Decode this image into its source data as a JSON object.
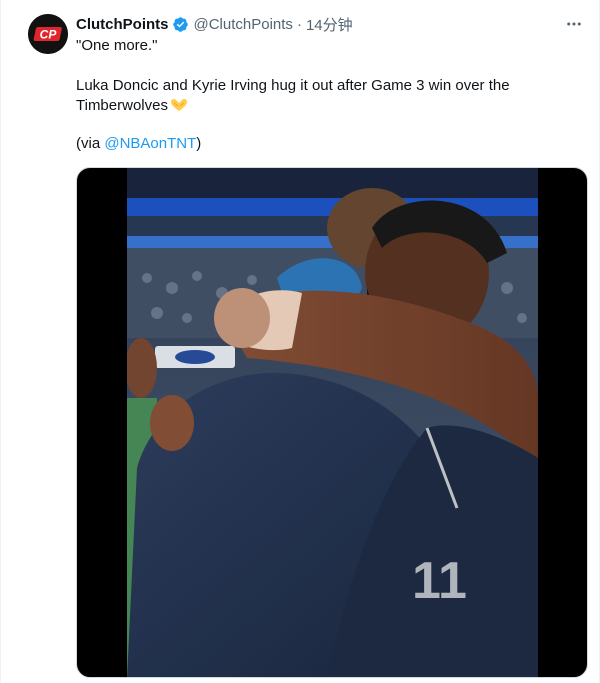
{
  "tweet": {
    "display_name": "ClutchPoints",
    "handle": "@ClutchPoints",
    "separator": "·",
    "time": "14分钟",
    "avatar_text": "CP",
    "quote": "\"One more.\"",
    "body_line_1": "Luka Doncic and Kyrie Irving hug it out after Game 3 win over the",
    "body_line_2": "Timberwolves",
    "via_prefix": "(via ",
    "via_mention": "@NBAonTNT",
    "via_suffix": ")",
    "verified_icon": "verified-badge-icon",
    "more_icon": "more-options-icon",
    "emoji_icon": "handshake-heart-emoji",
    "jersey_number": "11"
  },
  "colors": {
    "accent": "#1d9bf0",
    "secondary_text": "#536471",
    "verified_gold": "#e2b719",
    "brand_red": "#e0252c"
  }
}
